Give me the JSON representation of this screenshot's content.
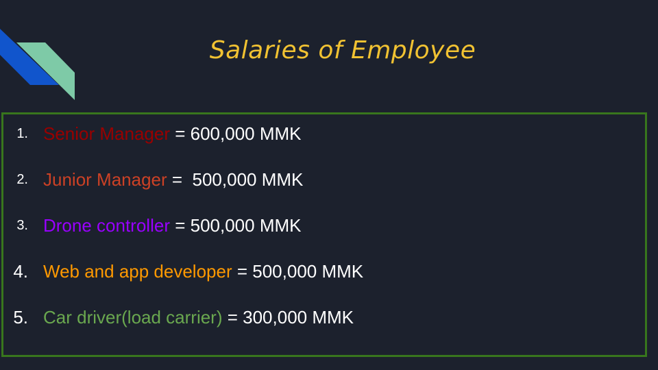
{
  "slide": {
    "title": "Salaries of Employee",
    "colors": {
      "background": "#1c212d",
      "title": "#f1c232",
      "border": "#38761d",
      "logo_blue": "#1155cc",
      "logo_green": "#7ecaa7"
    },
    "items": [
      {
        "number": "1.",
        "role": "Senior Manager",
        "role_color": "#990000",
        "salary": " = 600,000 MMK"
      },
      {
        "number": "2.",
        "role": "Junior Manager",
        "role_color": "#cc4125",
        "salary": " =  500,000 MMK"
      },
      {
        "number": "3.",
        "role": "Drone controller",
        "role_color": "#9900ff",
        "salary": " = 500,000 MMK"
      },
      {
        "number": "4.",
        "role": "Web and app developer",
        "role_color": "#ff9900",
        "salary": " = 500,000 MMK"
      },
      {
        "number": "5.",
        "role": "Car driver(load carrier)",
        "role_color": "#6aa84f",
        "salary": " = 300,000 MMK"
      }
    ]
  }
}
